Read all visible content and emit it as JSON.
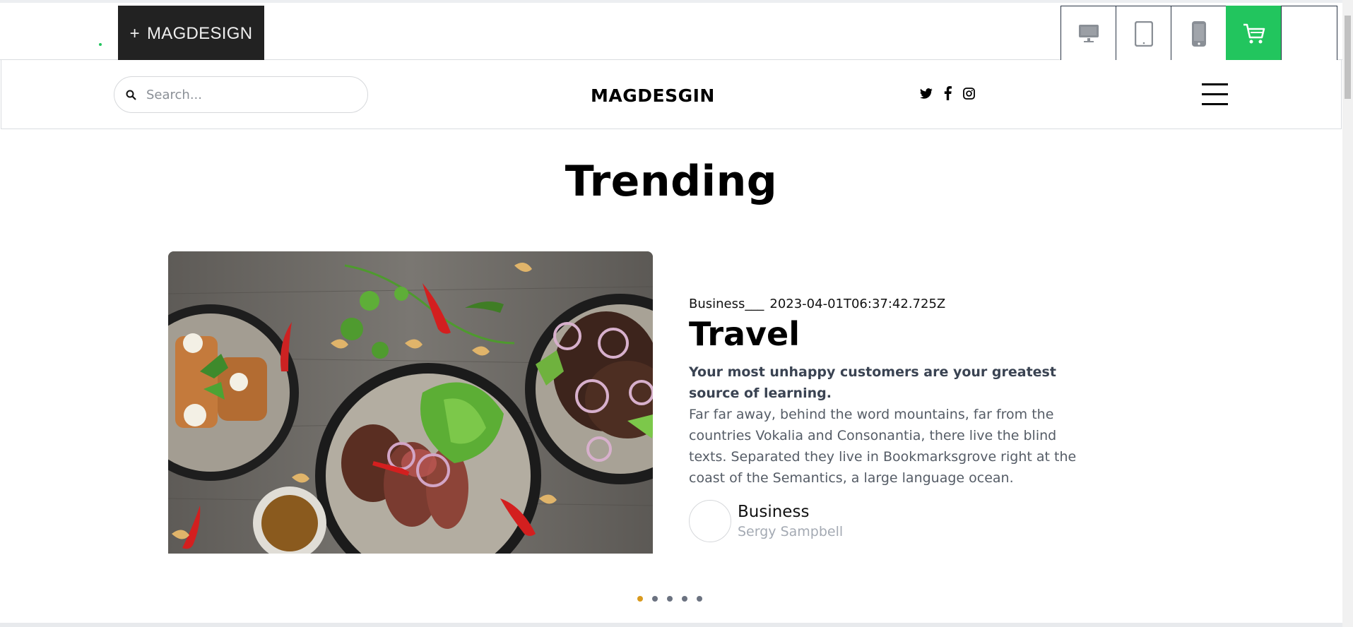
{
  "toolbar": {
    "brand_plus": "+",
    "brand_label": "MAGDESIGN",
    "devices": [
      "desktop-icon",
      "tablet-icon",
      "mobile-icon",
      "cart-icon"
    ],
    "accent": "#22c55e"
  },
  "nav": {
    "search_placeholder": "Search...",
    "site_title": "MAGDESGIN",
    "socials": [
      "twitter-icon",
      "facebook-icon",
      "instagram-icon"
    ]
  },
  "trending": {
    "heading": "Trending",
    "post": {
      "category": "Business___",
      "date": "2023-04-01T06:37:42.725Z",
      "title": "Travel",
      "lead": "Your most unhappy customers are your greatest source of learning.",
      "body": "Far far away, behind the word mountains, far from the countries Vokalia and Consonantia, there live the blind texts. Separated they live in Bookmarksgrove right at the coast of the Semantics, a large language ocean.",
      "author_category": "Business",
      "author_name": "Sergy Sampbell"
    },
    "carousel": {
      "count": 5,
      "active": 1,
      "active_color": "#d99a1e"
    }
  }
}
